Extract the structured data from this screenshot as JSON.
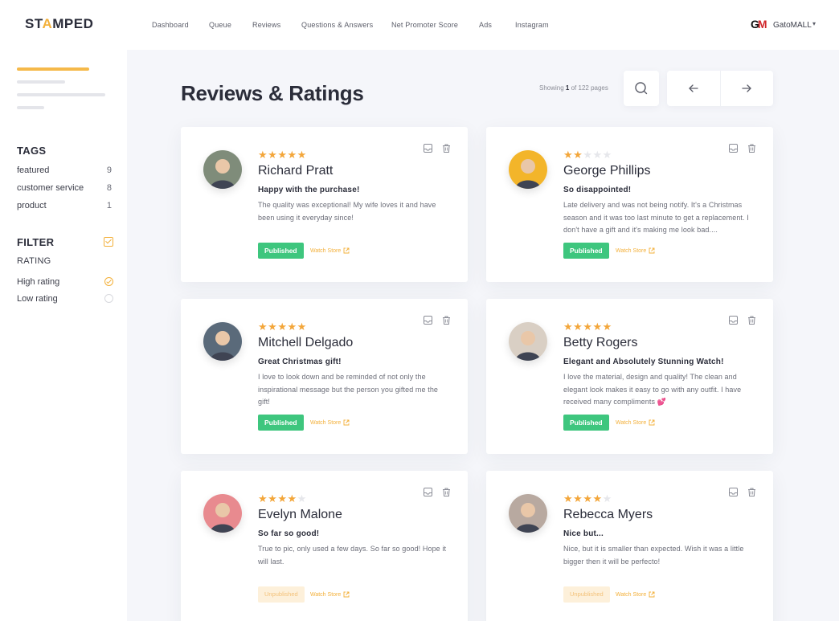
{
  "brand": {
    "logo_pre": "ST",
    "logo_star": "A",
    "logo_post": "MPED"
  },
  "sidebar": {
    "tags_title": "TAGS",
    "tags": [
      {
        "label": "featured",
        "count": "9"
      },
      {
        "label": "customer service",
        "count": "8"
      },
      {
        "label": "product",
        "count": "1"
      }
    ],
    "filter_title": "FILTER",
    "rating_label": "RATING",
    "rating_options": [
      {
        "label": "High rating",
        "checked": true
      },
      {
        "label": "Low rating",
        "checked": false
      }
    ]
  },
  "nav": {
    "items": [
      "Dashboard",
      "Queue",
      "Reviews",
      "Questions & Answers",
      "Net Promoter Score",
      "Ads",
      "Instagram"
    ],
    "store_logo_g": "G",
    "store_logo_m": "M",
    "store_name": "GatoMALL"
  },
  "header": {
    "title": "Reviews & Ratings",
    "showing_prefix": "Showing ",
    "showing_current": "1",
    "showing_suffix": " of 122 pages"
  },
  "reviews": [
    {
      "stars": 5,
      "name": "Richard Pratt",
      "headline": "Happy with the purchase!",
      "body": "The quality was exceptional! My wife loves it and have been using it everyday since!",
      "status": "Published",
      "published": true,
      "watch": "Watch Store",
      "avatar_color": "#7f8c7a"
    },
    {
      "stars": 2,
      "name": "George Phillips",
      "headline": "So disappointed!",
      "body": "Late delivery and was not being notify. It's a Christmas season and it was too last minute to get a replacement. I don't have a gift and it's making me look bad....",
      "status": "Published",
      "published": true,
      "watch": "Watch Store",
      "avatar_color": "#f3b52a"
    },
    {
      "stars": 5,
      "name": "Mitchell Delgado",
      "headline": "Great Christmas gift!",
      "body": "I love to look down and be reminded of not only the inspirational message but the person you gifted me the gift!",
      "status": "Published",
      "published": true,
      "watch": "Watch Store",
      "avatar_color": "#5a6a7a"
    },
    {
      "stars": 5,
      "name": "Betty Rogers",
      "headline": "Elegant and Absolutely Stunning Watch!",
      "body": "I love the material, design and quality! The clean and elegant look makes it easy to go with any outfit. I have received many compliments 💕",
      "status": "Published",
      "published": true,
      "watch": "Watch Store",
      "avatar_color": "#d9cfc4"
    },
    {
      "stars": 4,
      "name": "Evelyn Malone",
      "headline": "So far so good!",
      "body": "True to pic, only used a few days. So far so good! Hope it will last.",
      "status": "Unpublished",
      "published": false,
      "watch": "Watch Store",
      "avatar_color": "#e88a8f"
    },
    {
      "stars": 4,
      "name": "Rebecca Myers",
      "headline": "Nice but...",
      "body": "Nice, but it is smaller than expected. Wish it was a little bigger then it will be perfecto!",
      "status": "Unpublished",
      "published": false,
      "watch": "Watch Store",
      "avatar_color": "#b8a9a0"
    }
  ],
  "colors": {
    "accent": "#f3b03a",
    "published": "#3ec67e",
    "star": "#f3a63a"
  }
}
